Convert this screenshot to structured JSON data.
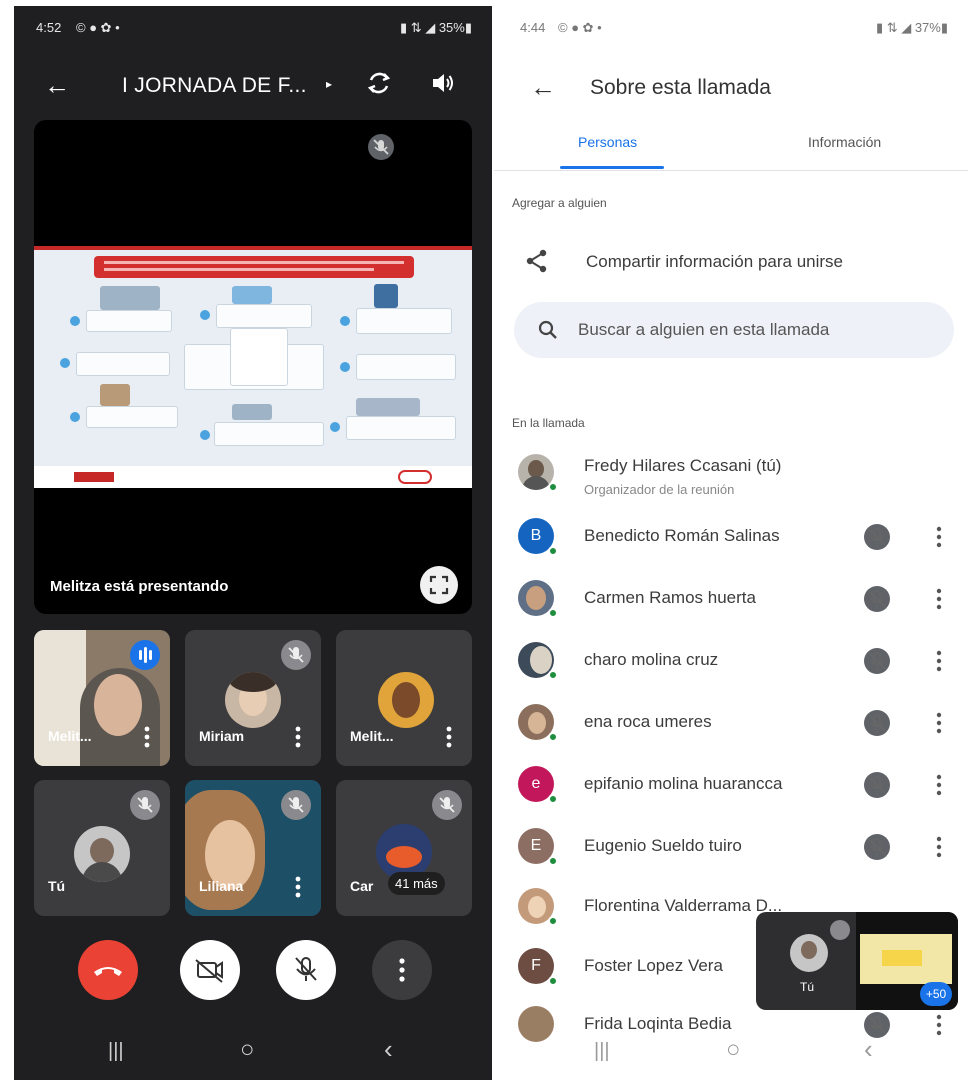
{
  "left_phone": {
    "status_bar": {
      "time": "4:52",
      "notif_icons": "© ● ✿ •",
      "right_icons": "▮ ⇅ ◢ 35%▮"
    },
    "top_bar": {
      "back": "←",
      "title": "I JORNADA DE F...",
      "chevron": "▸"
    },
    "presentation": {
      "label": "Melitza está presentando"
    },
    "tiles": [
      {
        "name": "Melit..."
      },
      {
        "name": "Miriam"
      },
      {
        "name": "Melit..."
      },
      {
        "name": "Tú"
      },
      {
        "name": "Liliana"
      },
      {
        "name": "Car",
        "more": "41 más"
      }
    ],
    "nav": {
      "recents": "|||",
      "home": "○",
      "back": "‹"
    }
  },
  "right_phone": {
    "status_bar": {
      "time": "4:44",
      "notif_icons": "© ● ✿ •",
      "right_icons": "▮ ⇅ ◢ 37%▮"
    },
    "header": {
      "back": "←",
      "title": "Sobre esta llamada"
    },
    "tabs": [
      {
        "label": "Personas",
        "active": true
      },
      {
        "label": "Información",
        "active": false
      }
    ],
    "add_label": "Agregar a alguien",
    "share_label": "Compartir información para unirse",
    "search_placeholder": "Buscar a alguien en esta llamada",
    "in_call_label": "En la llamada",
    "participants": [
      {
        "name": "Fredy Hilares Ccasani (tú)",
        "subtitle": "Organizador de la reunión",
        "avatar": "photo"
      },
      {
        "name": "Benedicto Román Salinas",
        "avatar_letter": "B",
        "color": "#1565c0"
      },
      {
        "name": "Carmen Ramos huerta",
        "avatar": "photo"
      },
      {
        "name": "charo molina cruz",
        "avatar": "photo"
      },
      {
        "name": "ena roca umeres",
        "avatar": "photo"
      },
      {
        "name": "epifanio molina huarancca",
        "avatar_letter": "e",
        "color": "#c2185b"
      },
      {
        "name": "Eugenio Sueldo tuiro",
        "avatar_letter": "E",
        "color": "#8d6e63"
      },
      {
        "name": "Florentina Valderrama D...",
        "avatar": "photo"
      },
      {
        "name": "Foster Lopez Vera",
        "avatar_letter": "F",
        "color": "#6d4c41"
      },
      {
        "name": "Frida Loqinta Bedia",
        "avatar": "photo"
      }
    ],
    "pip": {
      "you": "Tú",
      "count": "+50"
    },
    "nav": {
      "recents": "|||",
      "home": "○",
      "back": "‹"
    }
  }
}
